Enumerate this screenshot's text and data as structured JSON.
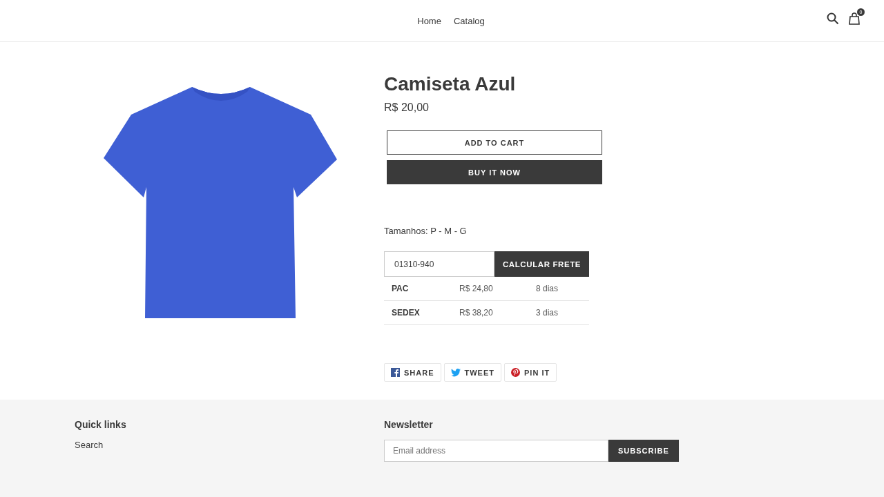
{
  "header": {
    "nav": [
      {
        "label": "Home"
      },
      {
        "label": "Catalog"
      }
    ],
    "cart_count": "0"
  },
  "product": {
    "title": "Camiseta Azul",
    "price": "R$ 20,00",
    "add_to_cart": "ADD TO CART",
    "buy_now": "BUY IT NOW",
    "description": "Tamanhos: P - M - G"
  },
  "shipping": {
    "zip_value": "01310-940",
    "button": "CALCULAR FRETE",
    "rows": [
      {
        "service": "PAC",
        "price": "R$ 24,80",
        "time": "8 dias"
      },
      {
        "service": "SEDEX",
        "price": "R$ 38,20",
        "time": "3 dias"
      }
    ]
  },
  "share": [
    {
      "kind": "facebook",
      "label": "SHARE"
    },
    {
      "kind": "twitter",
      "label": "TWEET"
    },
    {
      "kind": "pinterest",
      "label": "PIN IT"
    }
  ],
  "footer": {
    "quick_links_title": "Quick links",
    "links": [
      "Search"
    ],
    "newsletter_title": "Newsletter",
    "email_placeholder": "Email address",
    "subscribe": "SUBSCRIBE"
  }
}
